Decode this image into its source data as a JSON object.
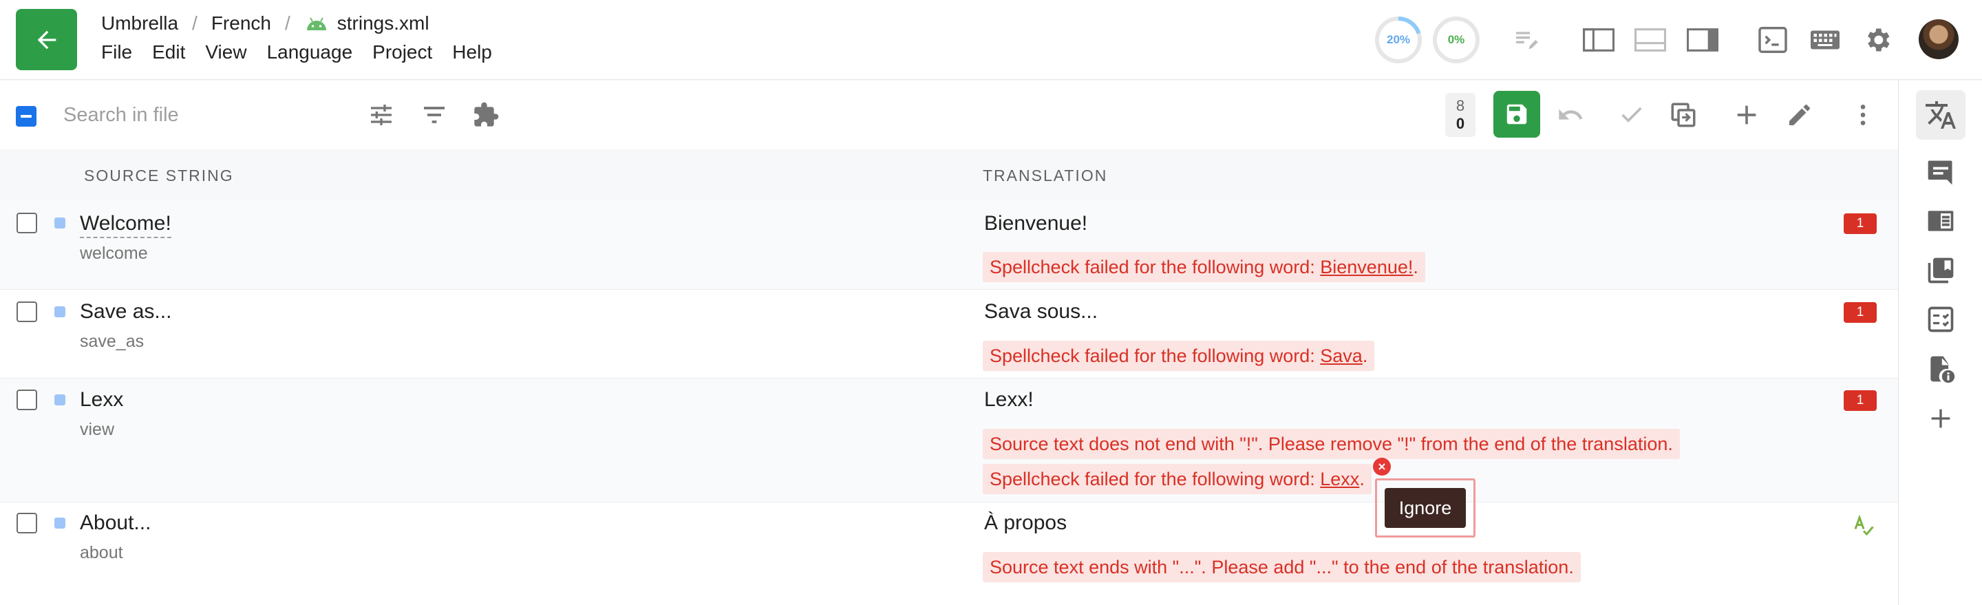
{
  "header": {
    "breadcrumb": [
      "Umbrella",
      "French",
      "strings.xml"
    ],
    "menu": [
      "File",
      "Edit",
      "View",
      "Language",
      "Project",
      "Help"
    ],
    "progress_translated": "20%",
    "progress_approved": "0%"
  },
  "toolbar": {
    "search_placeholder": "Search in file",
    "counter_top": "8",
    "counter_bottom": "0"
  },
  "table": {
    "columns": [
      "SOURCE STRING",
      "TRANSLATION"
    ],
    "rows": [
      {
        "source": "Welcome!",
        "key": "welcome",
        "translation": "Bienvenue!",
        "issue_count": "1",
        "issues": [
          {
            "text": "Spellcheck failed for the following word: ",
            "word": "Bienvenue!",
            "tail": "."
          }
        ]
      },
      {
        "source": "Save as...",
        "key": "save_as",
        "translation": "Sava sous...",
        "issue_count": "1",
        "issues": [
          {
            "text": "Spellcheck failed for the following word: ",
            "word": "Sava",
            "tail": "."
          }
        ]
      },
      {
        "source": "Lexx",
        "key": "view",
        "translation": "Lexx!",
        "issue_count": "1",
        "issues": [
          {
            "text": "Source text does not end with \"!\". Please remove \"!\" from the end of the translation.",
            "word": "",
            "tail": ""
          },
          {
            "text": "Spellcheck failed for the following word: ",
            "word": "Lexx",
            "tail": "."
          }
        ]
      },
      {
        "source": "About...",
        "key": "about",
        "translation": "À propos",
        "issue_count": "",
        "issues": [
          {
            "text": "Source text ends with \"...\". Please add \"...\" to the end of the translation.",
            "word": "",
            "tail": ""
          }
        ]
      }
    ]
  },
  "tooltip": {
    "ignore_label": "Ignore"
  },
  "colors": {
    "brand_green": "#2e9d47",
    "error_red": "#d93025",
    "error_bg": "#fbe4e2",
    "checkbox_blue": "#1a73e8"
  },
  "icons": {
    "header": [
      "arrow-left-icon",
      "android-icon",
      "edit-list-icon",
      "layout-left-icon",
      "layout-bottom-icon",
      "layout-right-icon",
      "terminal-icon",
      "keyboard-icon",
      "gear-icon"
    ],
    "toolbar": [
      "sliders-icon",
      "filter-icon",
      "puzzle-icon",
      "save-icon",
      "undo-icon",
      "check-icon",
      "copy-source-icon",
      "plus-icon",
      "pencil-icon",
      "more-vert-icon"
    ],
    "rail": [
      "translate-icon",
      "comment-icon",
      "tm-icon",
      "book-icon",
      "qa-checklist-icon",
      "file-info-icon",
      "plus-icon"
    ]
  }
}
